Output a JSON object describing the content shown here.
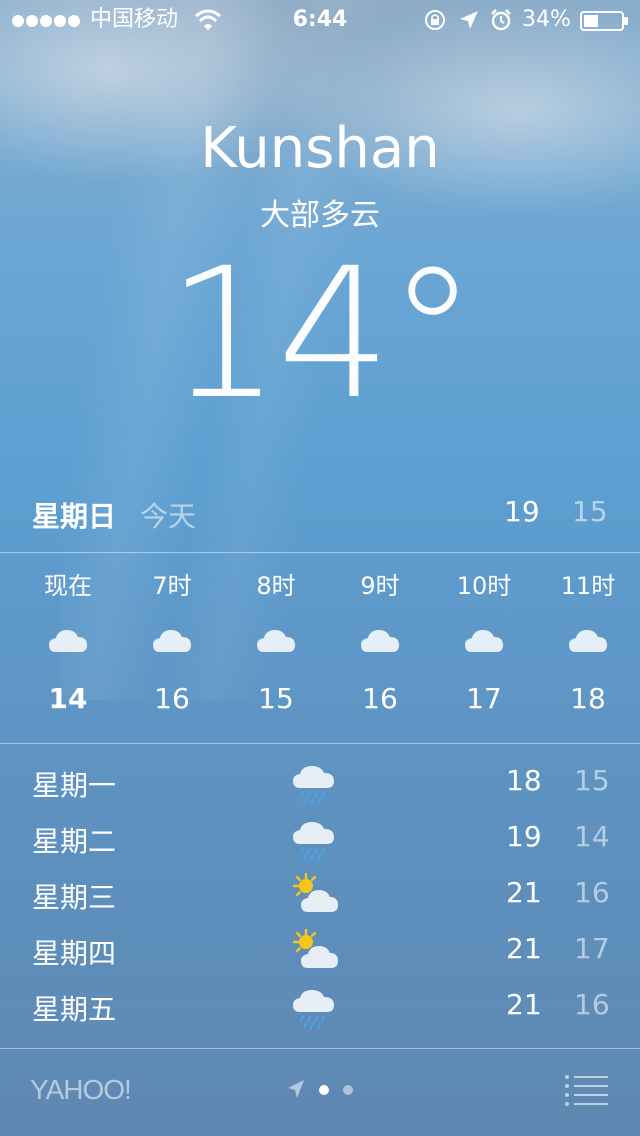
{
  "status_bar": {
    "carrier": "中国移动",
    "time": "6:44",
    "battery": "34%"
  },
  "header": {
    "city": "Kunshan",
    "condition": "大部多云",
    "temperature": "14°"
  },
  "today": {
    "day": "星期日",
    "label": "今天",
    "high": "19",
    "low": "15"
  },
  "hourly": [
    {
      "label": "现在",
      "icon": "cloud-icon",
      "temp": "14"
    },
    {
      "label": "7时",
      "icon": "cloud-icon",
      "temp": "16"
    },
    {
      "label": "8时",
      "icon": "cloud-icon",
      "temp": "15"
    },
    {
      "label": "9时",
      "icon": "cloud-icon",
      "temp": "16"
    },
    {
      "label": "10时",
      "icon": "cloud-icon",
      "temp": "17"
    },
    {
      "label": "11时",
      "icon": "cloud-icon",
      "temp": "18"
    }
  ],
  "daily": [
    {
      "day": "星期一",
      "icon": "rain-cloud-icon",
      "high": "18",
      "low": "15"
    },
    {
      "day": "星期二",
      "icon": "rain-cloud-icon",
      "high": "19",
      "low": "14"
    },
    {
      "day": "星期三",
      "icon": "partly-sunny-icon",
      "high": "21",
      "low": "16"
    },
    {
      "day": "星期四",
      "icon": "partly-sunny-icon",
      "high": "21",
      "low": "17"
    },
    {
      "day": "星期五",
      "icon": "rain-cloud-icon",
      "high": "21",
      "low": "16"
    }
  ],
  "footer": {
    "logo": "YAHOO!"
  },
  "colors": {
    "sky_top": "#8aaecd",
    "sky_bottom": "#5f88b2",
    "sun": "#f5c518",
    "rain": "#4aa3e8"
  }
}
